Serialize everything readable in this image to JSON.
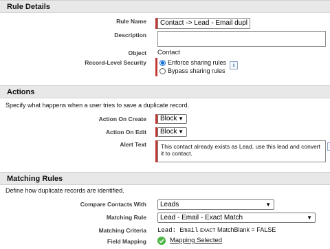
{
  "rule_details": {
    "header": "Rule Details",
    "rule_name_label": "Rule Name",
    "rule_name_value": "Contact -> Lead - Email dupl",
    "description_label": "Description",
    "description_value": "",
    "object_label": "Object",
    "object_value": "Contact",
    "sharing_label": "Record-Level Security",
    "sharing_options": [
      "Enforce sharing rules",
      "Bypass sharing rules"
    ],
    "sharing_selected": "Enforce sharing rules",
    "info_glyph": "i"
  },
  "actions": {
    "header": "Actions",
    "description": "Specify what happens when a user tries to save a duplicate record.",
    "on_create_label": "Action On Create",
    "on_create_value": "Block",
    "on_edit_label": "Action On Edit",
    "on_edit_value": "Block",
    "alert_label": "Alert Text",
    "alert_value": "This contact already exists as Lead, use this lead and convert it to contact."
  },
  "matching_rules": {
    "header": "Matching Rules",
    "description": "Define how duplicate records are identified.",
    "compare_label": "Compare Contacts With",
    "compare_value": "Leads",
    "rule_label": "Matching Rule",
    "rule_value": "Lead - Email - Exact Match",
    "criteria_label": "Matching Criteria",
    "criteria_field": "Lead: Email",
    "criteria_exact": "EXACT",
    "criteria_rest": "MatchBlank = FALSE",
    "mapping_label": "Field Mapping",
    "mapping_link": "Mapping Selected"
  },
  "colors": {
    "required_bar": "#c23934",
    "header_bg": "#e8e8e8",
    "radio_selected": "#0b6bd3",
    "check_green": "#4bb543"
  },
  "icons": [
    "info-icon",
    "chevron-down-icon",
    "green-check-icon"
  ]
}
